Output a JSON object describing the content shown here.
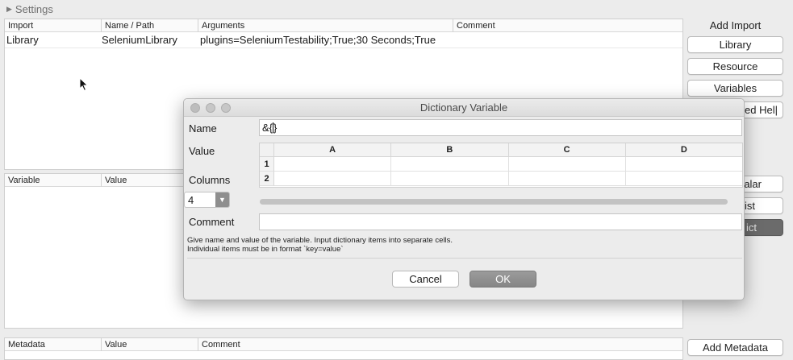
{
  "settings": {
    "label": "Settings"
  },
  "imports": {
    "columns": [
      "Import",
      "Name / Path",
      "Arguments",
      "Comment"
    ],
    "rows": [
      {
        "import": "Library",
        "name": "SeleniumLibrary",
        "arguments": "plugins=SeleniumTestability;True;30 Seconds;True",
        "comment": ""
      }
    ]
  },
  "variables": {
    "columns": [
      "Variable",
      "Value"
    ]
  },
  "metadata": {
    "columns": [
      "Metadata",
      "Value",
      "Comment"
    ]
  },
  "side": {
    "add_import": "Add Import",
    "library": "Library",
    "resource": "Resource",
    "variables": "Variables",
    "help_partial": "ed Hel|",
    "scalar_partial": "alar",
    "list_partial": "ist",
    "dict_partial": "ict",
    "add_metadata": "Add Metadata"
  },
  "dialog": {
    "title": "Dictionary Variable",
    "name_label": "Name",
    "name_value": "&{",
    "name_value_tail": "}",
    "value_label": "Value",
    "grid": {
      "headers": [
        "A",
        "B",
        "C",
        "D"
      ],
      "rows": [
        "1",
        "2"
      ]
    },
    "columns_label": "Columns",
    "columns_value": "4",
    "comment_label": "Comment",
    "help_line1": "Give name and value of the variable. Input dictionary items into separate cells.",
    "help_line2": "Individual items must be in format `key=value`",
    "cancel": "Cancel",
    "ok": "OK"
  }
}
